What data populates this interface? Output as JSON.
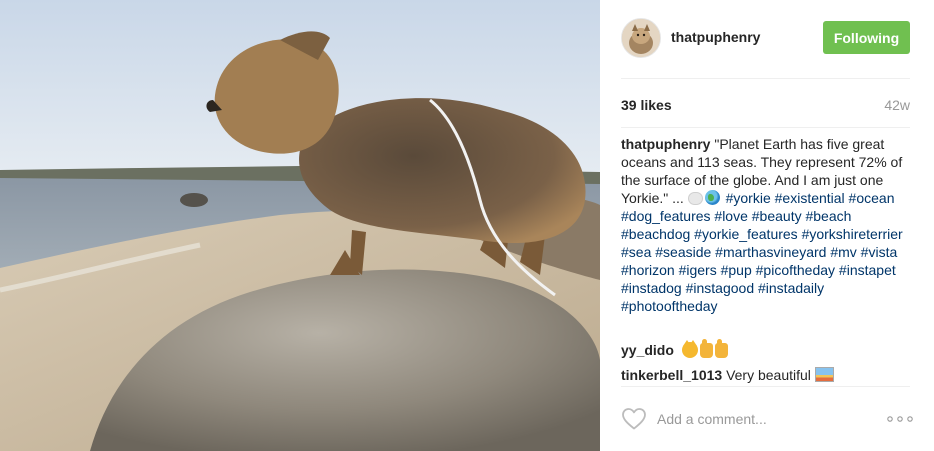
{
  "post": {
    "photo_alt": "",
    "author": {
      "username": "thatpuphenry",
      "avatar_icon": "dog-avatar"
    },
    "follow_button": {
      "label": "Following",
      "color": "#70c050"
    },
    "likes": "39 likes",
    "age": "42w",
    "caption": {
      "username": "thatpuphenry",
      "text": "\"Planet Earth has five great oceans and 113 seas. They represent 72% of the surface of the globe. And I am just one Yorkie.\" ...",
      "emojis": [
        "speech-bubble-emoji",
        "globe-emoji"
      ],
      "hashtags": "#yorkie #existential #ocean #dog_features #love #beauty #beach #beachdog #yorkie_features #yorkshireterrier #sea #seaside #marthasvineyard #mv #vista #horizon #igers #pup #picoftheday #instapet #instadog #instagood #instadaily #photooftheday"
    },
    "comments": [
      {
        "username": "yy_dido",
        "text": "",
        "emojis": [
          "cat-emoji",
          "thumbs-up-emoji",
          "thumbs-up-emoji"
        ]
      },
      {
        "username": "tinkerbell_1013",
        "text": "Very beautiful",
        "emojis": [
          "sunset-picture-emoji"
        ]
      }
    ],
    "comment_box": {
      "placeholder": "Add a comment...",
      "like_icon": "heart-icon",
      "more_icon": "more-options-icon"
    },
    "colors": {
      "link_blue": "#003569",
      "muted": "#999999",
      "text": "#262626"
    }
  }
}
